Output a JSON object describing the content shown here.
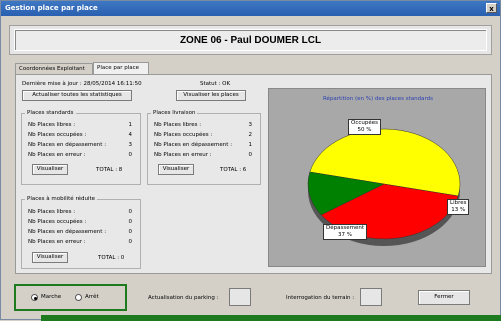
{
  "window": {
    "title": "Gestion place par place",
    "close_label": "x"
  },
  "header": {
    "zone_title": "ZONE 06 - Paul DOUMER LCL"
  },
  "tabs": [
    {
      "label": "Coordonnées Exploitant"
    },
    {
      "label": "Place par place"
    }
  ],
  "info": {
    "last_update": "Dernière mise à jour : 28/05/2014 16:11:50",
    "status": "Statut : OK"
  },
  "buttons": {
    "refresh_stats": "Actualiser toutes les statistiques",
    "view_places": "Visualiser les places",
    "view": "Visualiser",
    "close": "Fermer"
  },
  "groups": {
    "standard": {
      "title": "Places standards",
      "rows": [
        {
          "label": "Nb Places libres :",
          "value": "1"
        },
        {
          "label": "Nb Places occupées :",
          "value": "4"
        },
        {
          "label": "Nb Places en dépassement :",
          "value": "3"
        },
        {
          "label": "Nb Places en erreur :",
          "value": "0"
        }
      ],
      "total": "TOTAL : 8"
    },
    "delivery": {
      "title": "Places livraison",
      "rows": [
        {
          "label": "Nb Places libres :",
          "value": "3"
        },
        {
          "label": "Nb Places occupées :",
          "value": "2"
        },
        {
          "label": "Nb Places en dépassement :",
          "value": "1"
        },
        {
          "label": "Nb Places en erreur :",
          "value": "0"
        }
      ],
      "total": "TOTAL : 6"
    },
    "reduced": {
      "title": "Places à mobilité réduite",
      "rows": [
        {
          "label": "Nb Places libres :",
          "value": "0"
        },
        {
          "label": "Nb Places occupées :",
          "value": "0"
        },
        {
          "label": "Nb Places en dépassement :",
          "value": "0"
        },
        {
          "label": "Nb Places en erreur :",
          "value": "0"
        }
      ],
      "total": "TOTAL : 0"
    }
  },
  "chart": {
    "title": "Répartition (en %) des places standards",
    "labels": {
      "occupied": {
        "name": "Occupées",
        "pct": "50 %"
      },
      "free": {
        "name": "Libres",
        "pct": "13 %"
      },
      "overdue": {
        "name": "Dépassement",
        "pct": "37 %"
      }
    },
    "colors": {
      "occupied": "#ffff00",
      "overdue": "#ff0000",
      "free": "#008000"
    }
  },
  "chart_data": {
    "type": "pie",
    "title": "Répartition (en %) des places standards",
    "slices": [
      {
        "name": "Occupées",
        "value": 50
      },
      {
        "name": "Dépassement",
        "value": 37
      },
      {
        "name": "Libres",
        "value": 13
      }
    ]
  },
  "footer": {
    "mode_on": "Marche",
    "mode_off": "Arrêt",
    "mode_selected": "Marche",
    "parking_refresh": "Actualisation du parking :",
    "terrain_query": "Interrogation du terrain :"
  }
}
